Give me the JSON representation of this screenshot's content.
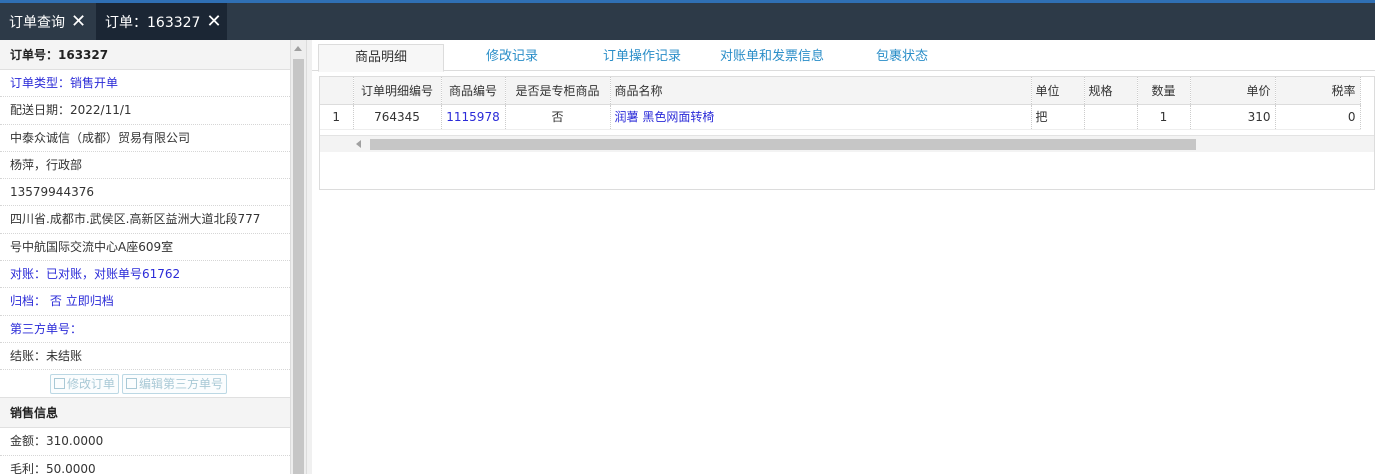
{
  "tabs": [
    {
      "label": "订单查询"
    },
    {
      "label": "订单：163327"
    }
  ],
  "sidebar": {
    "order_no": "订单号：163327",
    "order_type": "订单类型：销售开单",
    "delivery_date": "配送日期：2022/11/1",
    "company": "中泰众诚信（成都）贸易有限公司",
    "contact": "杨萍，行政部",
    "phone": "13579944376",
    "address_line1": "四川省.成都市.武侯区.高新区益洲大道北段777",
    "address_line2": "号中航国际交流中心A座609室",
    "reconcile": "对账：已对账，对账单号61762",
    "archive_label": "归档：",
    "archive_value": "否",
    "archive_link": "立即归档",
    "third_party": "第三方单号：",
    "settlement": "结账：未结账",
    "edit_order_btn": "修改订单",
    "edit_third_btn": "编辑第三方单号",
    "sales_section": "销售信息",
    "amount": "金额：310.0000",
    "profit": "毛利：50.0000"
  },
  "subtabs": [
    {
      "label": "商品明细",
      "active": true
    },
    {
      "label": "修改记录"
    },
    {
      "label": "订单操作记录"
    },
    {
      "label": "对账单和发票信息"
    },
    {
      "label": "包裹状态"
    }
  ],
  "table": {
    "columns": [
      "",
      "订单明细编号",
      "商品编号",
      "是否是专柜商品",
      "商品名称",
      "单位",
      "规格",
      "数量",
      "单价",
      "税率"
    ],
    "rows": [
      {
        "idx": "1",
        "detail_no": "764345",
        "product_no": "1115978",
        "is_counter": "否",
        "name": "润薯 黑色网面转椅",
        "unit": "把",
        "spec": "",
        "qty": "1",
        "price": "310",
        "tax": "0"
      }
    ]
  },
  "colors": {
    "accent": "#2f6fb4",
    "tabbar": "#2d3a48",
    "link": "#2b2bd8",
    "subtab": "#2a8ec8"
  }
}
